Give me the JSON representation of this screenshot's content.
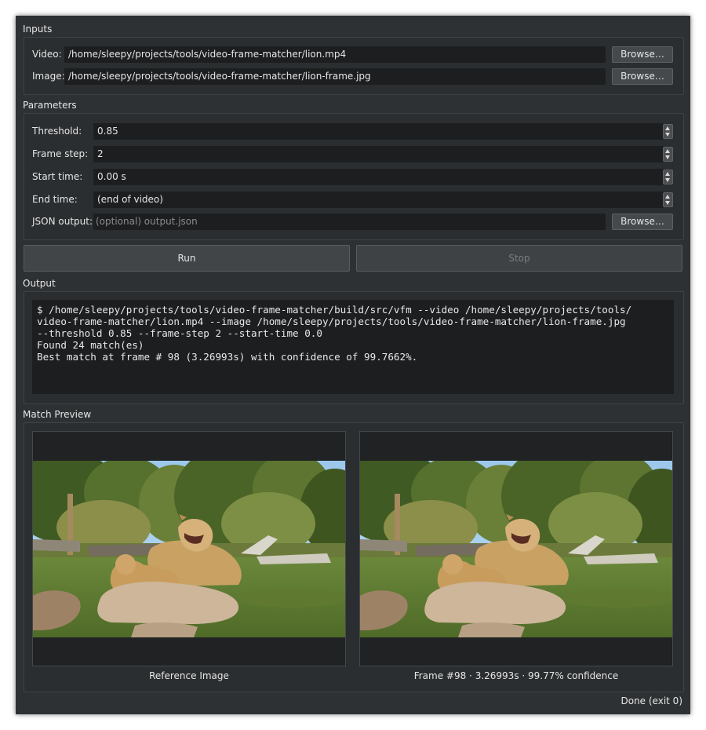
{
  "inputs": {
    "title": "Inputs",
    "video_label": "Video:",
    "video_value": "/home/sleepy/projects/tools/video-frame-matcher/lion.mp4",
    "image_label": "Image:",
    "image_value": "/home/sleepy/projects/tools/video-frame-matcher/lion-frame.jpg",
    "browse_label": "Browse…"
  },
  "parameters": {
    "title": "Parameters",
    "threshold_label": "Threshold:",
    "threshold_value": "0.85",
    "frame_step_label": "Frame step:",
    "frame_step_value": "2",
    "start_time_label": "Start time:",
    "start_time_value": "0.00 s",
    "end_time_label": "End time:",
    "end_time_value": "(end of video)",
    "json_output_label": "JSON output:",
    "json_output_placeholder": "(optional) output.json",
    "browse_label": "Browse…"
  },
  "actions": {
    "run_label": "Run",
    "stop_label": "Stop"
  },
  "output": {
    "title": "Output",
    "lines": [
      "$ /home/sleepy/projects/tools/video-frame-matcher/build/src/vfm --video /home/sleepy/projects/tools/",
      "video-frame-matcher/lion.mp4 --image /home/sleepy/projects/tools/video-frame-matcher/lion-frame.jpg",
      "--threshold 0.85 --frame-step 2 --start-time 0.0",
      "Found 24 match(es)",
      "Best match at frame # 98 (3.26993s) with confidence of 99.7662%."
    ]
  },
  "preview": {
    "title": "Match Preview",
    "reference_caption": "Reference Image",
    "match_caption": "Frame #98 · 3.26993s · 99.77% confidence"
  },
  "status": {
    "text": "Done (exit 0)"
  },
  "colors": {
    "window_bg": "#2e3133",
    "field_bg": "#1c1e1f",
    "disabled_text": "#7b7e80"
  }
}
